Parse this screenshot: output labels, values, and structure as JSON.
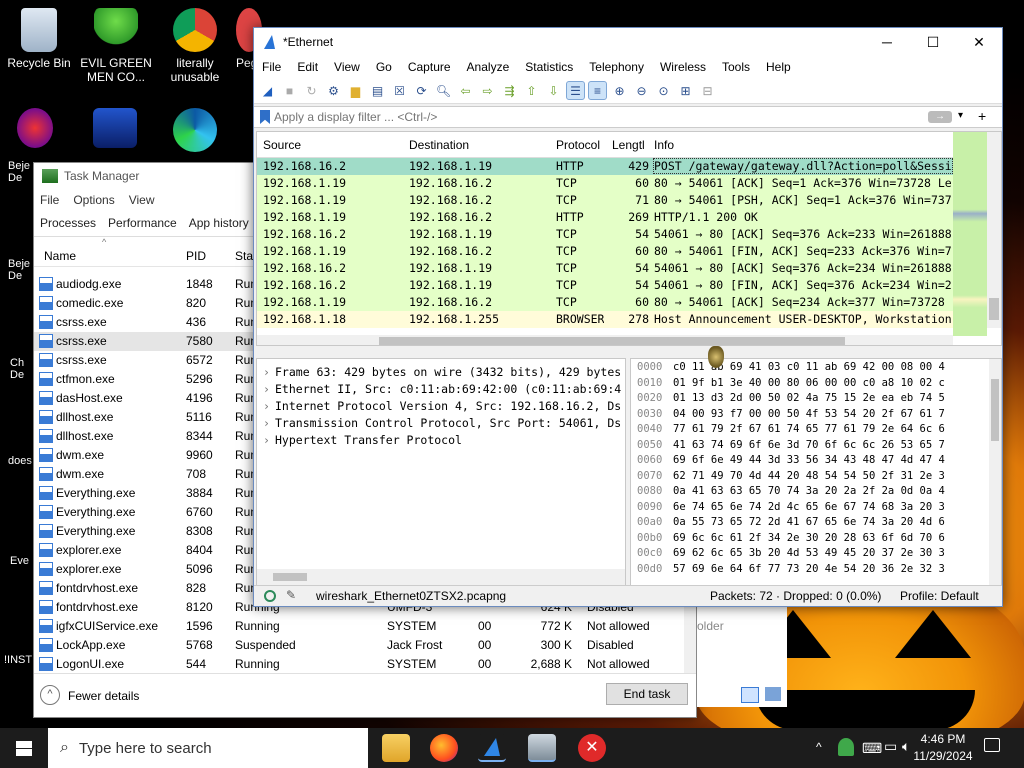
{
  "desktop": {
    "icons": [
      {
        "label": "Recycle Bin"
      },
      {
        "label": "EVIL GREEN MEN CO..."
      },
      {
        "label": "literally unusable"
      },
      {
        "label": "Peg"
      }
    ],
    "left_edge_labels": [
      "Beje De",
      "Beje De",
      "Ch De",
      "does",
      "Eve",
      "!INST"
    ]
  },
  "task_manager": {
    "title": "Task Manager",
    "menu": [
      "File",
      "Options",
      "View"
    ],
    "tabs": [
      "Processes",
      "Performance",
      "App history"
    ],
    "columns": {
      "name": "Name",
      "pid": "PID",
      "status": "Stat"
    },
    "rows": [
      {
        "name": "audiodg.exe",
        "pid": "1848",
        "status": "Run"
      },
      {
        "name": "comedic.exe",
        "pid": "820",
        "status": "Run"
      },
      {
        "name": "csrss.exe",
        "pid": "436",
        "status": "Run"
      },
      {
        "name": "csrss.exe",
        "pid": "7580",
        "status": "Run"
      },
      {
        "name": "csrss.exe",
        "pid": "6572",
        "status": "Run"
      },
      {
        "name": "ctfmon.exe",
        "pid": "5296",
        "status": "Run"
      },
      {
        "name": "dasHost.exe",
        "pid": "4196",
        "status": "Run"
      },
      {
        "name": "dllhost.exe",
        "pid": "5116",
        "status": "Run"
      },
      {
        "name": "dllhost.exe",
        "pid": "8344",
        "status": "Run"
      },
      {
        "name": "dwm.exe",
        "pid": "9960",
        "status": "Run"
      },
      {
        "name": "dwm.exe",
        "pid": "708",
        "status": "Run"
      },
      {
        "name": "Everything.exe",
        "pid": "3884",
        "status": "Run"
      },
      {
        "name": "Everything.exe",
        "pid": "6760",
        "status": "Run"
      },
      {
        "name": "Everything.exe",
        "pid": "8308",
        "status": "Run"
      },
      {
        "name": "explorer.exe",
        "pid": "8404",
        "status": "Run"
      },
      {
        "name": "explorer.exe",
        "pid": "5096",
        "status": "Run"
      },
      {
        "name": "fontdrvhost.exe",
        "pid": "828",
        "status": "Run"
      },
      {
        "name": "fontdrvhost.exe",
        "pid": "8120",
        "status": "Running",
        "user": "UMFD-3",
        "cpu": "",
        "mem": "624 K",
        "uac": "Disabled"
      },
      {
        "name": "igfxCUIService.exe",
        "pid": "1596",
        "status": "Running",
        "user": "SYSTEM",
        "cpu": "00",
        "mem": "772 K",
        "uac": "Not allowed"
      },
      {
        "name": "LockApp.exe",
        "pid": "5768",
        "status": "Suspended",
        "user": "Jack Frost",
        "cpu": "00",
        "mem": "300 K",
        "uac": "Disabled"
      },
      {
        "name": "LogonUI.exe",
        "pid": "544",
        "status": "Running",
        "user": "SYSTEM",
        "cpu": "00",
        "mem": "2,688 K",
        "uac": "Not allowed"
      }
    ],
    "fewer_details": "Fewer details",
    "end_task": "End task",
    "behind_text": "older"
  },
  "wireshark": {
    "title": "*Ethernet",
    "menu": [
      "File",
      "Edit",
      "View",
      "Go",
      "Capture",
      "Analyze",
      "Statistics",
      "Telephony",
      "Wireless",
      "Tools",
      "Help"
    ],
    "filter_placeholder": "Apply a display filter ... <Ctrl-/>",
    "columns": {
      "source": "Source",
      "destination": "Destination",
      "protocol": "Protocol",
      "length": "Lengtl",
      "info": "Info"
    },
    "packets": [
      {
        "src": "192.168.16.2",
        "dst": "192.168.1.19",
        "proto": "HTTP",
        "len": "429",
        "info": "POST /gateway/gateway.dll?Action=poll&Sessi",
        "color": "#a0dcc8"
      },
      {
        "src": "192.168.1.19",
        "dst": "192.168.16.2",
        "proto": "TCP",
        "len": "60",
        "info": "80 → 54061 [ACK] Seq=1 Ack=376 Win=73728 Le",
        "color": "#e4ffc7"
      },
      {
        "src": "192.168.1.19",
        "dst": "192.168.16.2",
        "proto": "TCP",
        "len": "71",
        "info": "80 → 54061 [PSH, ACK] Seq=1 Ack=376 Win=737",
        "color": "#e4ffc7"
      },
      {
        "src": "192.168.1.19",
        "dst": "192.168.16.2",
        "proto": "HTTP",
        "len": "269",
        "info": "HTTP/1.1 200 OK",
        "color": "#e4ffc7"
      },
      {
        "src": "192.168.16.2",
        "dst": "192.168.1.19",
        "proto": "TCP",
        "len": "54",
        "info": "54061 → 80 [ACK] Seq=376 Ack=233 Win=261888",
        "color": "#e4ffc7"
      },
      {
        "src": "192.168.1.19",
        "dst": "192.168.16.2",
        "proto": "TCP",
        "len": "60",
        "info": "80 → 54061 [FIN, ACK] Seq=233 Ack=376 Win=7",
        "color": "#e4ffc7"
      },
      {
        "src": "192.168.16.2",
        "dst": "192.168.1.19",
        "proto": "TCP",
        "len": "54",
        "info": "54061 → 80 [ACK] Seq=376 Ack=234 Win=261888",
        "color": "#e4ffc7"
      },
      {
        "src": "192.168.16.2",
        "dst": "192.168.1.19",
        "proto": "TCP",
        "len": "54",
        "info": "54061 → 80 [FIN, ACK] Seq=376 Ack=234 Win=2",
        "color": "#e4ffc7"
      },
      {
        "src": "192.168.1.19",
        "dst": "192.168.16.2",
        "proto": "TCP",
        "len": "60",
        "info": "80 → 54061 [ACK] Seq=234 Ack=377 Win=73728",
        "color": "#e4ffc7"
      },
      {
        "src": "192.168.1.18",
        "dst": "192.168.1.255",
        "proto": "BROWSER",
        "len": "278",
        "info": "Host Announcement USER-DESKTOP, Workstation",
        "color": "#fffcd9"
      }
    ],
    "details": [
      "Frame 63: 429 bytes on wire (3432 bits), 429 bytes",
      "Ethernet II, Src: c0:11:ab:69:42:00 (c0:11:ab:69:4",
      "Internet Protocol Version 4, Src: 192.168.16.2, Ds",
      "Transmission Control Protocol, Src Port: 54061, Ds",
      "Hypertext Transfer Protocol"
    ],
    "hex": [
      [
        "0000",
        "c0 11 ab 69 41 03 c0 11  ab 69 42 00 08 00 4"
      ],
      [
        "0010",
        "01 9f b1 3e 40 00 80 06  00 00 c0 a8 10 02 c"
      ],
      [
        "0020",
        "01 13 d3 2d 00 50 02 4a  75 15 2e ea eb 74 5"
      ],
      [
        "0030",
        "04 00 93 f7 00 00 50 4f  53 54 20 2f 67 61 7"
      ],
      [
        "0040",
        "77 61 79 2f 67 61 74 65  77 61 79 2e 64 6c 6"
      ],
      [
        "0050",
        "41 63 74 69 6f 6e 3d 70  6f 6c 6c 26 53 65 7"
      ],
      [
        "0060",
        "69 6f 6e 49 44 3d 33 56  34 43 48 47 4d 47 4"
      ],
      [
        "0070",
        "62 71 49 70 4d 44 20 48  54 54 50 2f 31 2e 3"
      ],
      [
        "0080",
        "0a 41 63 63 65 70 74 3a  20 2a 2f 2a 0d 0a 4"
      ],
      [
        "0090",
        "6e 74 65 6e 74 2d 4c 65  6e 67 74 68 3a 20 3"
      ],
      [
        "00a0",
        "0a 55 73 65 72 2d 41 67  65 6e 74 3a 20 4d 6"
      ],
      [
        "00b0",
        "69 6c 6c 61 2f 34 2e 30  20 28 63 6f 6d 70 6"
      ],
      [
        "00c0",
        "69 62 6c 65 3b 20 4d 53  49 45 20 37 2e 30 3"
      ],
      [
        "00d0",
        "57 69 6e 64 6f 77 73 20  4e 54 20 36 2e 32 3"
      ]
    ],
    "status_file": "wireshark_Ethernet0ZTSX2.pcapng",
    "status_packets": "Packets: 72 · Dropped: 0 (0.0%)",
    "status_profile": "Profile: Default"
  },
  "taskbar": {
    "search_placeholder": "Type here to search",
    "time": "4:46 PM",
    "date": "11/29/2024"
  }
}
